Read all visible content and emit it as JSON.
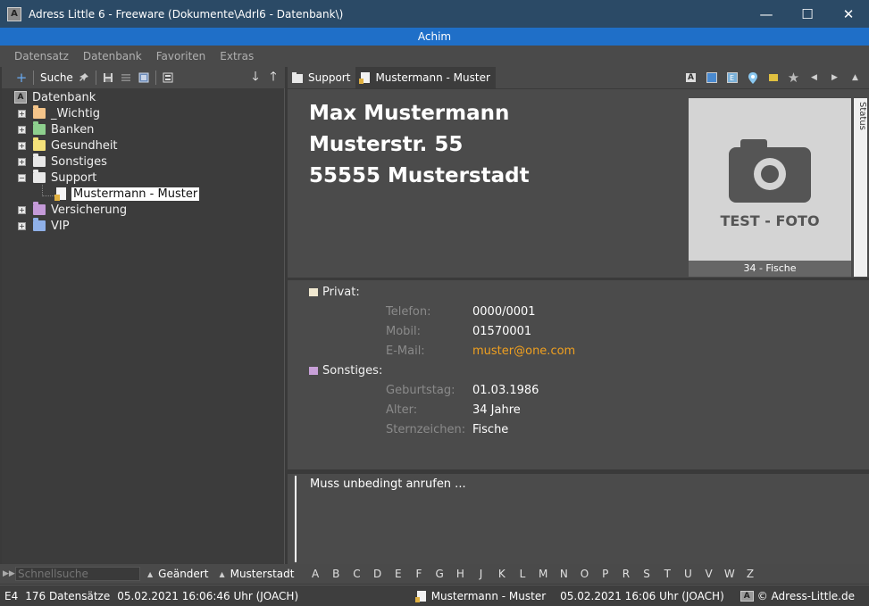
{
  "window": {
    "title": "Adress Little 6 - Freeware (Dokumente\\Adrl6 - Datenbank\\)",
    "app_icon_letter": "A",
    "controls": {
      "minimize": "—",
      "maximize": "☐",
      "close": "✕"
    }
  },
  "user": "Achim",
  "menu": [
    "Datensatz",
    "Datenbank",
    "Favoriten",
    "Extras"
  ],
  "tree_toolbar": {
    "add": "+",
    "search_label": "Suche"
  },
  "tree": {
    "root": "Datenbank",
    "items": [
      {
        "label": "_Wichtig",
        "color": "#f5c58a",
        "expander": "+"
      },
      {
        "label": "Banken",
        "color": "#8ed08e",
        "expander": "+"
      },
      {
        "label": "Gesundheit",
        "color": "#f4e27a",
        "expander": "+"
      },
      {
        "label": "Sonstiges",
        "color": "#e8e8e8",
        "expander": "+"
      },
      {
        "label": "Support",
        "color": "#e8e8e8",
        "expander": "−"
      },
      {
        "label": "Versicherung",
        "color": "#c49ad8",
        "expander": "+"
      },
      {
        "label": "VIP",
        "color": "#8fb0e8",
        "expander": "+"
      }
    ],
    "child": {
      "label": "Mustermann - Muster"
    }
  },
  "detail_tabs": [
    "Support",
    "Mustermann - Muster"
  ],
  "contact": {
    "name": "Max Mustermann",
    "street": "Musterstr. 55",
    "city": "55555 Musterstadt",
    "photo_text": "TEST - FOTO",
    "photo_caption": "34 - Fische",
    "status_tab": "Status"
  },
  "sections": {
    "privat": {
      "title": "Privat:",
      "color": "#f0e8d0",
      "fields": [
        {
          "label": "Telefon:",
          "value": "0000/0001"
        },
        {
          "label": "Mobil:",
          "value": "01570001"
        },
        {
          "label": "E-Mail:",
          "value": "muster@one.com"
        }
      ]
    },
    "sonstiges": {
      "title": "Sonstiges:",
      "color": "#c8a0d8",
      "fields": [
        {
          "label": "Geburtstag:",
          "value": "01.03.1986"
        },
        {
          "label": "Alter:",
          "value": "34 Jahre"
        },
        {
          "label": "Sternzeichen:",
          "value": "Fische"
        }
      ]
    }
  },
  "notes": "Muss unbedingt anrufen ...",
  "filterbar": {
    "quicksearch_placeholder": "Schnellsuche",
    "sort1": "Geändert",
    "sort2": "Musterstadt",
    "letters": [
      "A",
      "B",
      "C",
      "D",
      "E",
      "F",
      "G",
      "H",
      "J",
      "K",
      "L",
      "M",
      "N",
      "O",
      "P",
      "R",
      "S",
      "T",
      "U",
      "V",
      "W",
      "Z"
    ]
  },
  "statusbar": {
    "code": "E4",
    "count": "176 Datensätze",
    "datetime": "05.02.2021 16:06:46 Uhr (JOACH)",
    "record": "Mustermann - Muster",
    "record_changed": "05.02.2021 16:06 Uhr (JOACH)",
    "copyright": "© Adress-Little.de"
  }
}
